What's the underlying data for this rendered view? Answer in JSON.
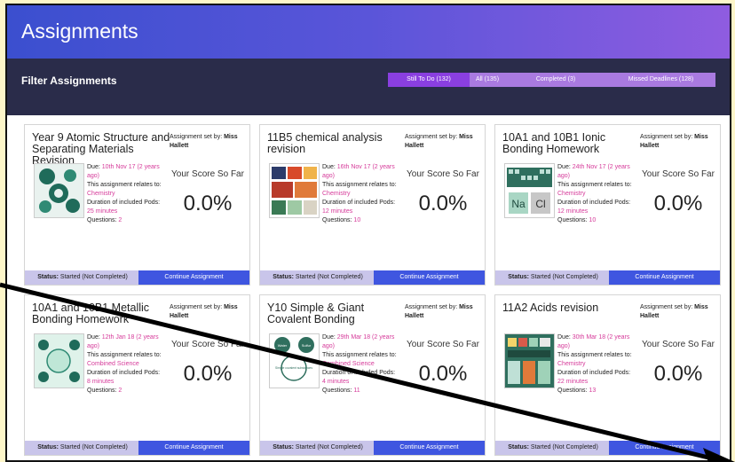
{
  "header": {
    "title": "Assignments"
  },
  "filter": {
    "label": "Filter Assignments",
    "tabs": [
      {
        "label": "Still To Do (132)"
      },
      {
        "label": "All (135)"
      },
      {
        "label": "Completed (3)"
      },
      {
        "label": "Missed Deadlines (128)"
      }
    ]
  },
  "cards": [
    {
      "title": "Year 9 Atomic Structure and Separating Materials Revision",
      "setter_prefix": "Assignment set by:",
      "setter_name": "Miss Hallett",
      "due_prefix": "Due:",
      "due": "10th Nov 17 (2 years ago)",
      "relates": "This assignment relates to:",
      "subject": "Chemistry",
      "duration_label": "Duration of included Pods:",
      "duration": "25 minutes",
      "questions_label": "Questions:",
      "questions": "2",
      "score_label": "Your Score So Far",
      "score": "0.0%",
      "status_label": "Status:",
      "status_value": "Started (Not Completed)",
      "button": "Continue Assignment"
    },
    {
      "title": "11B5 chemical analysis revision",
      "setter_prefix": "Assignment set by:",
      "setter_name": "Miss Hallett",
      "due_prefix": "Due:",
      "due": "16th Nov 17 (2 years ago)",
      "relates": "This assignment relates to:",
      "subject": "Chemistry",
      "duration_label": "Duration of included Pods:",
      "duration": "12 minutes",
      "questions_label": "Questions:",
      "questions": "10",
      "score_label": "Your Score So Far",
      "score": "0.0%",
      "status_label": "Status:",
      "status_value": "Started (Not Completed)",
      "button": "Continue Assignment"
    },
    {
      "title": "10A1 and 10B1 Ionic Bonding Homework",
      "setter_prefix": "Assignment set by:",
      "setter_name": "Miss Hallett",
      "due_prefix": "Due:",
      "due": "24th Nov 17 (2 years ago)",
      "relates": "This assignment relates to:",
      "subject": "Chemistry",
      "duration_label": "Duration of included Pods:",
      "duration": "12 minutes",
      "questions_label": "Questions:",
      "questions": "10",
      "score_label": "Your Score So Far",
      "score": "0.0%",
      "status_label": "Status:",
      "status_value": "Started (Not Completed)",
      "button": "Continue Assignment"
    },
    {
      "title": "10A1 and 10B1 Metallic Bonding Homework",
      "setter_prefix": "Assignment set by:",
      "setter_name": "Miss Hallett",
      "due_prefix": "Due:",
      "due": "12th Jan 18 (2 years ago)",
      "relates": "This assignment relates to:",
      "subject": "Combined Science",
      "duration_label": "Duration of included Pods:",
      "duration": "8 minutes",
      "questions_label": "Questions:",
      "questions": "2",
      "score_label": "Your Score So Far",
      "score": "0.0%",
      "status_label": "Status:",
      "status_value": "Started (Not Completed)",
      "button": "Continue Assignment"
    },
    {
      "title": "Y10 Simple & Giant Covalent Bonding",
      "setter_prefix": "Assignment set by:",
      "setter_name": "Miss Hallett",
      "due_prefix": "Due:",
      "due": "29th Mar 18 (2 years ago)",
      "relates": "This assignment relates to:",
      "subject": "Combined Science",
      "duration_label": "Duration of included Pods:",
      "duration": "4 minutes",
      "questions_label": "Questions:",
      "questions": "11",
      "score_label": "Your Score So Far",
      "score": "0.0%",
      "status_label": "Status:",
      "status_value": "Started (Not Completed)",
      "button": "Continue Assignment"
    },
    {
      "title": "11A2 Acids revision",
      "setter_prefix": "Assignment set by:",
      "setter_name": "Miss Hallett",
      "due_prefix": "Due:",
      "due": "30th Mar 18 (2 years ago)",
      "relates": "This assignment relates to:",
      "subject": "Chemistry",
      "duration_label": "Duration of included Pods:",
      "duration": "22 minutes",
      "questions_label": "Questions:",
      "questions": "13",
      "score_label": "Your Score So Far",
      "score": "0.0%",
      "status_label": "Status:",
      "status_value": "Started (Not Completed)",
      "button": "Continue Assignment"
    }
  ],
  "thumbnails": [
    {
      "icon": "atom-revision-thumbnail"
    },
    {
      "icon": "chemical-analysis-thumbnail"
    },
    {
      "icon": "periodic-table-thumbnail",
      "symbol_a": "Na",
      "symbol_b": "Cl"
    },
    {
      "icon": "metallic-bonding-thumbnail"
    },
    {
      "icon": "covalent-bonding-thumbnail",
      "bubble_a": "Water",
      "bubble_b": "Sulfur",
      "bubble_c": "Simple covalent substances"
    },
    {
      "icon": "acids-thumbnail"
    }
  ],
  "colors": {
    "accent": "#3f56e0",
    "pink": "#d63b9a",
    "tab_active": "#8a3fe0"
  }
}
